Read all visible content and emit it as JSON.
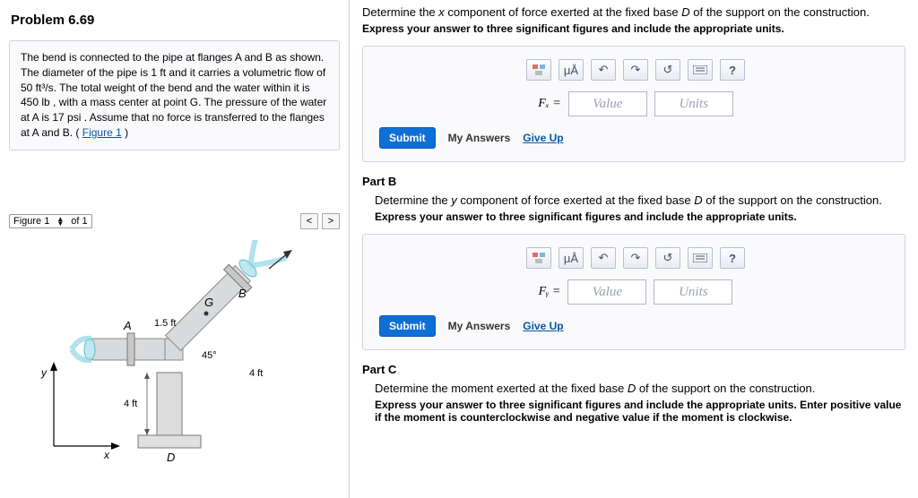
{
  "problem": {
    "title": "Problem 6.69",
    "body_html": "The bend is connected to the pipe at flanges A and B as shown. The diameter of the pipe is 1 ft and it carries a volumetric flow of 50 ft³/s. The total weight of the bend and the water within it is 450 lb , with a mass center at point G. The pressure of the water at A is 17 psi . Assume that no force is transferred to the flanges at A and B. (",
    "figure_link": "Figure 1",
    "body_close": ")"
  },
  "figure_selector": {
    "label": "Figure 1",
    "of_label": "of 1"
  },
  "diagram": {
    "labels": {
      "G": "G",
      "B": "B",
      "A": "A",
      "D": "D"
    },
    "dimensions": {
      "d1": "1.5 ft",
      "d2": "4 ft",
      "d3": "4 ft",
      "angle": "45°"
    },
    "axes": {
      "x": "x",
      "y": "y"
    }
  },
  "partA": {
    "prompt_html": "Determine the x component of force exerted at the fixed base D of the support on the construction.",
    "instruction": "Express your answer to three significant figures and include the appropriate units.",
    "var_label": "Fₓ =",
    "value_placeholder": "Value",
    "units_placeholder": "Units"
  },
  "partB": {
    "heading": "Part B",
    "prompt_html": "Determine the y component of force exerted at the fixed base D of the support on the construction.",
    "instruction": "Express your answer to three significant figures and include the appropriate units.",
    "var_label": "Fᵧ =",
    "value_placeholder": "Value",
    "units_placeholder": "Units"
  },
  "partC": {
    "heading": "Part C",
    "prompt_html": "Determine the moment exerted at the fixed base D of the support on the construction.",
    "instruction": "Express your answer to three significant figures and include the appropriate units. Enter positive value if the moment is counterclockwise and negative value if the moment is clockwise."
  },
  "common": {
    "submit": "Submit",
    "my_answers": "My Answers",
    "give_up": "Give Up",
    "help": "?",
    "toolbar_mu": "μÅ"
  }
}
